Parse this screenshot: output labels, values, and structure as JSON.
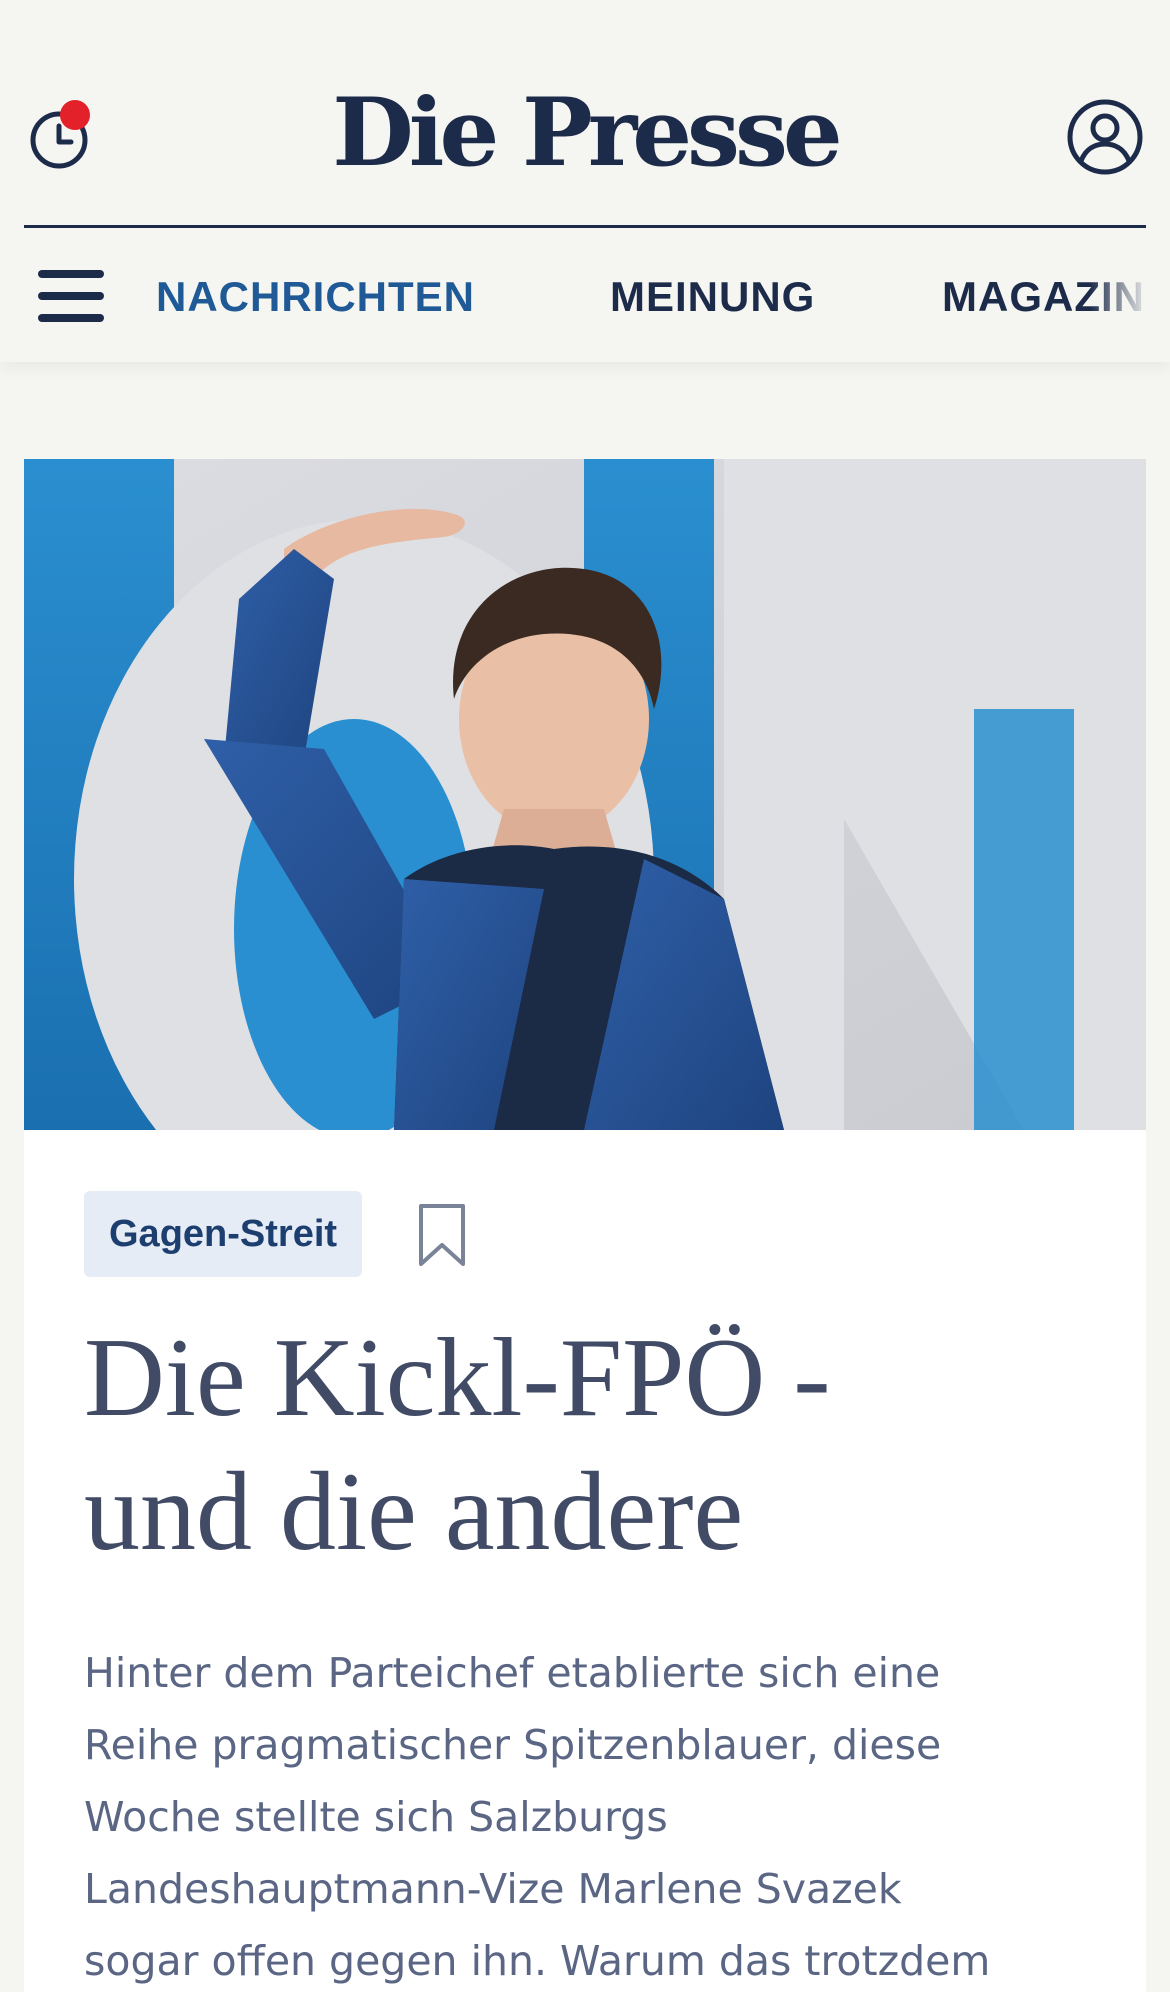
{
  "header": {
    "logo": "Die Presse",
    "icons": {
      "history": "clock-icon",
      "notification": "red-dot",
      "account": "user-circle-icon",
      "menu": "hamburger-icon"
    }
  },
  "nav": {
    "items": [
      {
        "label": "NACHRICHTEN",
        "active": true
      },
      {
        "label": "MEINUNG",
        "active": false
      },
      {
        "label": "MAGAZIN",
        "active": false
      }
    ]
  },
  "article": {
    "tag": "Gagen-Streit",
    "headline_lines": [
      "Die Kickl-FPÖ -",
      "und die andere"
    ],
    "teaser_lines": [
      "Hinter dem Parteichef etablierte sich eine",
      "Reihe pragmatischer Spitzenblauer, diese",
      "Woche stellte sich Salzburgs",
      "Landeshauptmann-Vize Marlene Svazek",
      "sogar offen gegen ihn. Warum das trotzdem"
    ]
  },
  "colors": {
    "brand": "#1d2b4a",
    "accent": "#1f5a96",
    "notification": "#e3212b",
    "tag_bg": "#e6ecf5",
    "background": "#f5f5f1"
  }
}
